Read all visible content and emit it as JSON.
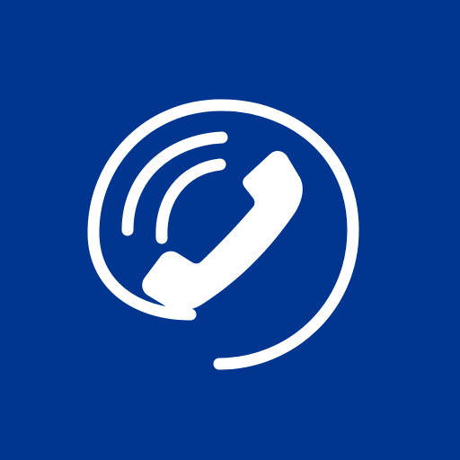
{
  "icon": {
    "name": "phone-call-icon",
    "background_color": "#00368F",
    "foreground_color": "#FFFFFF"
  }
}
